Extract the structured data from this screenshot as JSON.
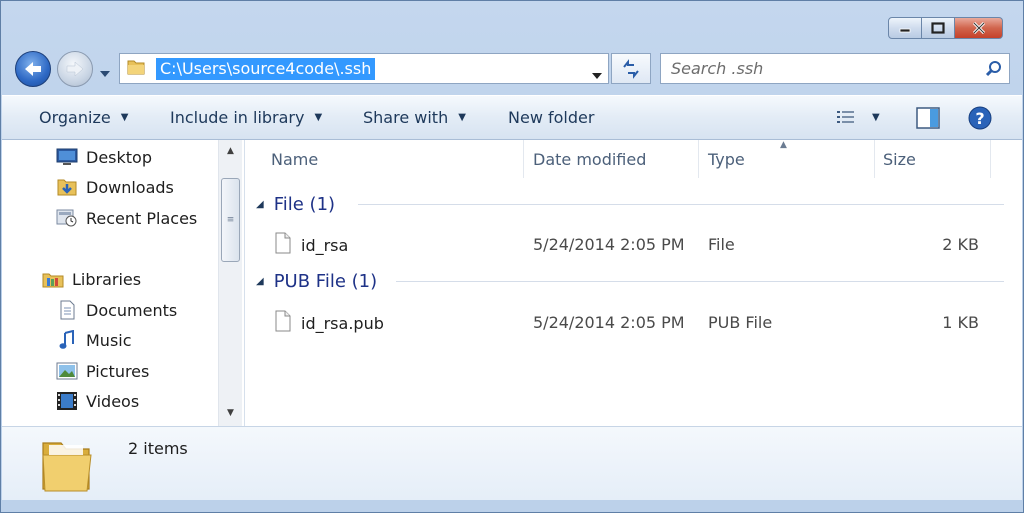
{
  "window": {
    "caption_buttons": [
      "minimize-icon",
      "maximize-icon",
      "close-icon"
    ]
  },
  "nav": {
    "address_path": "C:\\Users\\source4code\\.ssh",
    "search_placeholder": "Search .ssh"
  },
  "toolbar": {
    "organize": "Organize",
    "include_in_library": "Include in library",
    "share_with": "Share with",
    "new_folder": "New folder"
  },
  "sidebar": {
    "items": [
      {
        "label": "Desktop",
        "icon": "desktop-icon"
      },
      {
        "label": "Downloads",
        "icon": "downloads-folder-icon"
      },
      {
        "label": "Recent Places",
        "icon": "recent-places-icon"
      },
      {
        "label": "Libraries",
        "icon": "libraries-icon"
      },
      {
        "label": "Documents",
        "icon": "documents-icon"
      },
      {
        "label": "Music",
        "icon": "music-icon"
      },
      {
        "label": "Pictures",
        "icon": "pictures-icon"
      },
      {
        "label": "Videos",
        "icon": "videos-icon"
      }
    ]
  },
  "columns": {
    "name": "Name",
    "date_modified": "Date modified",
    "type": "Type",
    "size": "Size"
  },
  "groups": [
    {
      "title": "File (1)",
      "files": [
        {
          "name": "id_rsa",
          "date": "5/24/2014 2:05 PM",
          "type": "File",
          "size": "2 KB"
        }
      ]
    },
    {
      "title": "PUB File (1)",
      "files": [
        {
          "name": "id_rsa.pub",
          "date": "5/24/2014 2:05 PM",
          "type": "PUB File",
          "size": "1 KB"
        }
      ]
    }
  ],
  "details": {
    "item_count": "2 items"
  },
  "colors": {
    "accent_selection": "#3399ff",
    "group_title": "#1e3287",
    "toolbar_text": "#1e395b"
  }
}
